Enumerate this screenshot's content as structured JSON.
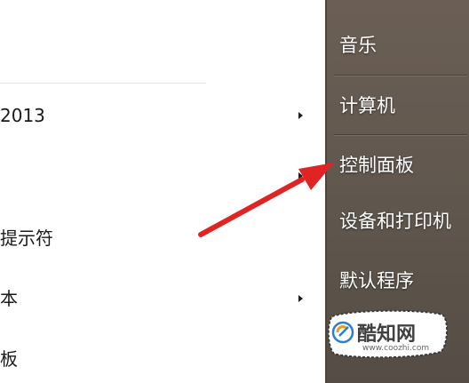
{
  "left_menu": {
    "items": [
      {
        "label": "2013",
        "has_submenu": true
      },
      {
        "label": "",
        "has_submenu": true
      },
      {
        "label": "提示符",
        "has_submenu": false
      },
      {
        "label": "本",
        "has_submenu": true
      },
      {
        "label": "板",
        "has_submenu": false
      }
    ]
  },
  "right_menu": {
    "items": [
      {
        "label": "音乐"
      },
      {
        "label": "计算机"
      },
      {
        "label": "控制面板"
      },
      {
        "label": "设备和打印机"
      },
      {
        "label": "默认程序"
      }
    ]
  },
  "watermark": {
    "logo_text": "酷知网",
    "url": "www.coozhi.com"
  },
  "colors": {
    "pane_bg": "#5f564d",
    "annotation_arrow": "#e02424"
  },
  "icons": {
    "submenu_arrow": "triangle-right",
    "annotation": "red-arrow-pointer"
  }
}
